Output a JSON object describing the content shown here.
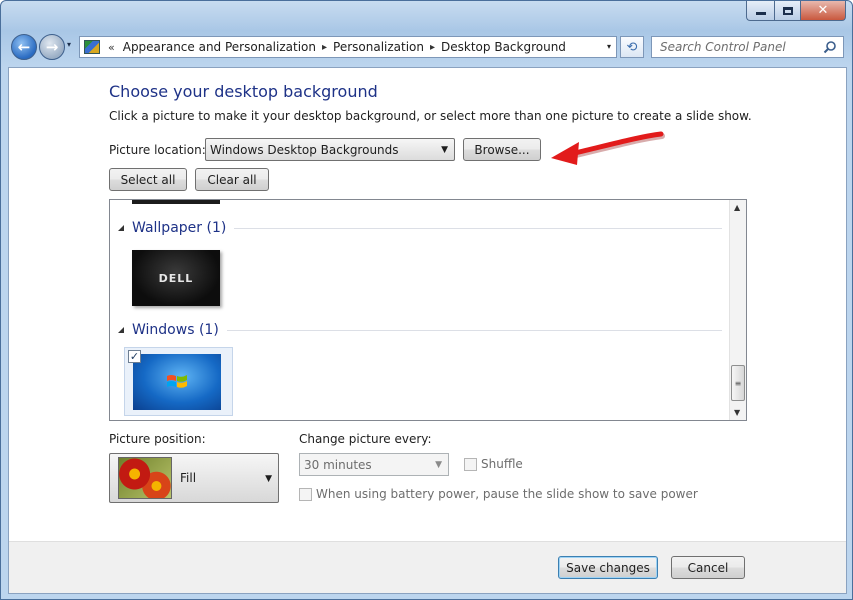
{
  "window": {
    "caption_buttons": {
      "minimize_icon": "minimize-icon",
      "maximize_icon": "maximize-icon",
      "close_glyph": "✕"
    }
  },
  "navigation": {
    "back_glyph": "←",
    "forward_glyph": "→",
    "recent_glyph": "▾",
    "overflow_glyph": "«",
    "separator_glyph": "▸",
    "breadcrumbs": [
      "Appearance and Personalization",
      "Personalization",
      "Desktop Background"
    ],
    "refresh_glyph": "⟲",
    "search": {
      "placeholder": "Search Control Panel",
      "value": ""
    }
  },
  "page": {
    "title": "Choose your desktop background",
    "instruction": "Click a picture to make it your desktop background, or select more than one picture to create a slide show.",
    "picture_location": {
      "label": "Picture location:",
      "value": "Windows Desktop Backgrounds"
    },
    "browse_label": "Browse...",
    "select_all_label": "Select all",
    "clear_all_label": "Clear all"
  },
  "gallery": {
    "groups": [
      {
        "title": "Wallpaper (1)",
        "thumbnail": "dell-wallpaper",
        "logo_text": "DELL",
        "selected": false
      },
      {
        "title": "Windows (1)",
        "thumbnail": "windows-7-wallpaper",
        "selected": true
      }
    ],
    "checkbox_glyph": "✓"
  },
  "options": {
    "picture_position": {
      "label": "Picture position:",
      "value": "Fill"
    },
    "change_every": {
      "label": "Change picture every:",
      "value": "30 minutes",
      "enabled": false
    },
    "shuffle": {
      "label": "Shuffle",
      "checked": false,
      "enabled": false
    },
    "battery": {
      "label": "When using battery power, pause the slide show to save power",
      "checked": false,
      "enabled": false
    }
  },
  "footer": {
    "save_label": "Save changes",
    "cancel_label": "Cancel"
  },
  "colors": {
    "title_blue": "#1e3287",
    "annotation_arrow": "#e21b1b"
  }
}
